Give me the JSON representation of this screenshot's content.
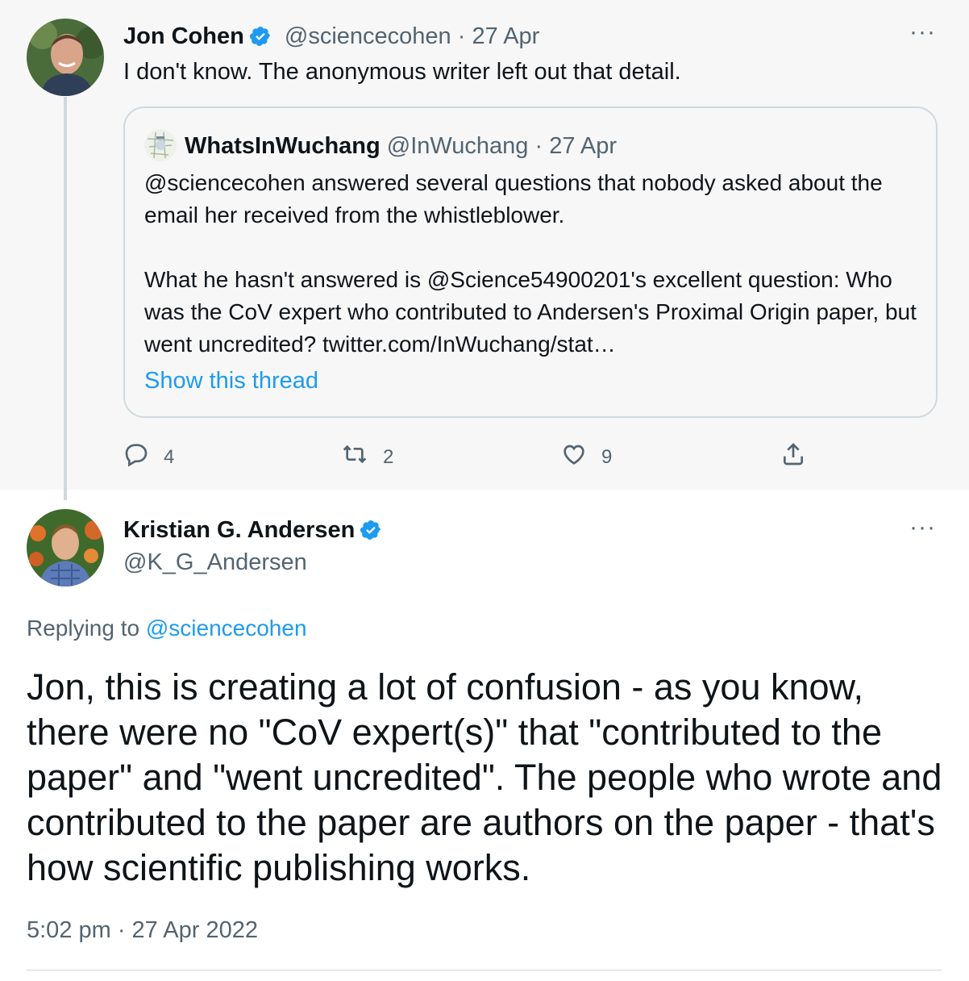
{
  "parent_tweet": {
    "author_name": "Jon Cohen",
    "handle": "@sciencecohen",
    "date": "27 Apr",
    "text": "I don't know. The anonymous writer left out that detail.",
    "quote": {
      "author_name": "WhatsInWuchang",
      "handle": "@InWuchang",
      "date": "27 Apr",
      "paragraph1": "@sciencecohen answered several questions that nobody asked about the email her received from the whistleblower.",
      "paragraph2": "What he hasn't answered is @Science54900201's excellent question: Who was the CoV expert who contributed to Andersen's Proximal Origin paper, but went uncredited? twitter.com/InWuchang/stat…",
      "show_thread": "Show this thread"
    },
    "actions": {
      "replies": "4",
      "retweets": "2",
      "likes": "9"
    }
  },
  "main_tweet": {
    "author_name": "Kristian G. Andersen",
    "handle": "@K_G_Andersen",
    "replying_prefix": "Replying to",
    "replying_to": "@sciencecohen",
    "text": "Jon, this is creating a lot of confusion - as you know, there were no \"CoV expert(s)\" that \"contributed to the paper\" and \"went uncredited\". The people who wrote and contributed to the paper are authors on the paper - that's how scientific publishing works.",
    "timestamp": "5:02 pm · 27 Apr 2022"
  },
  "separator": "·",
  "more_glyph": "···",
  "colors": {
    "accent": "#1d9bf0",
    "muted": "#536471",
    "text": "#0f1419",
    "parent_bg": "#f7f7f7",
    "border": "#cfd9de"
  },
  "icons": [
    "verified-badge-icon",
    "reply-icon",
    "retweet-icon",
    "like-icon",
    "share-icon",
    "more-icon"
  ]
}
